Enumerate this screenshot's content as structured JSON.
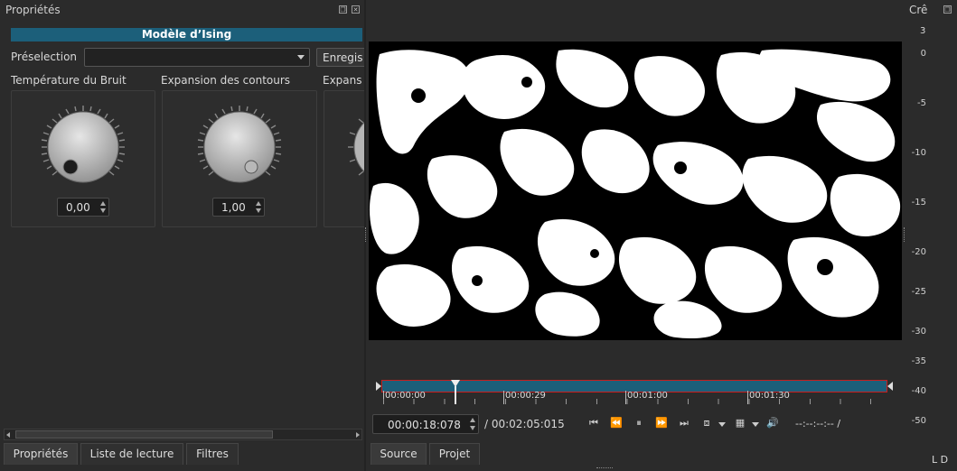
{
  "left_panel": {
    "title": "Propriétés",
    "filter_name": "Modèle d’Ising",
    "preset_label": "Préselection",
    "preset_value": "",
    "save_label": "Enregis",
    "params": [
      {
        "label": "Température du Bruit",
        "value": "0,00"
      },
      {
        "label": "Expansion des contours",
        "value": "1,00"
      },
      {
        "label": "Expans"
      }
    ],
    "tabs": [
      "Propriétés",
      "Liste de lecture",
      "Filtres"
    ]
  },
  "player": {
    "timeline_ticks": [
      "00:00:00",
      "00:00:29",
      "00:01:00",
      "00:01:30"
    ],
    "current_time": "00:00:18:078",
    "total_time": "/ 00:02:05:015",
    "in_out": "--:--:--:-- /",
    "tabs": [
      "Source",
      "Projet"
    ],
    "playhead_fraction": 0.14
  },
  "meter": {
    "title": "Crê",
    "peak": "3",
    "scale": [
      "0",
      "-5",
      "-10",
      "-15",
      "-20",
      "-25",
      "-30",
      "-35",
      "-40",
      "-50"
    ],
    "channels": "L D"
  },
  "colors": {
    "accent": "#1c5f7a",
    "timeline_border": "#c81e1e"
  }
}
